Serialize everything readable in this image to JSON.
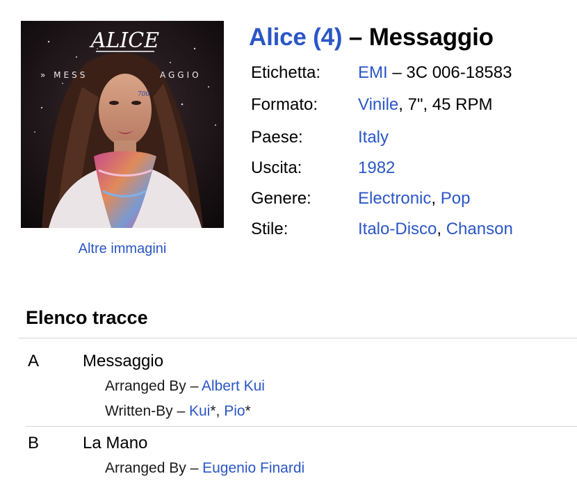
{
  "cover": {
    "logo_text": "ALICE",
    "sleeve_left": "» MESS",
    "sleeve_right": "AGGIO",
    "sticker": "700",
    "more_images_link": "Altre immagini"
  },
  "header": {
    "artist": "Alice (4)",
    "separator": " – ",
    "title": "Messaggio"
  },
  "profile": {
    "label_row": {
      "label": "Etichetta:",
      "label_link": "EMI",
      "catalog": " – 3C 006-18583"
    },
    "format_row": {
      "label": "Formato:",
      "format_link": "Vinile",
      "format_rest": ", 7\", 45 RPM"
    },
    "country_row": {
      "label": "Paese:",
      "value": "Italy"
    },
    "released_row": {
      "label": "Uscita:",
      "value": "1982"
    },
    "genre_row": {
      "label": "Genere:",
      "genre_1": "Electronic",
      "sep": ", ",
      "genre_2": "Pop"
    },
    "style_row": {
      "label": "Stile:",
      "style_1": "Italo-Disco",
      "sep": ", ",
      "style_2": "Chanson"
    }
  },
  "tracklist": {
    "heading": "Elenco tracce",
    "tracks": [
      {
        "position": "A",
        "title": "Messaggio",
        "credit_1": {
          "role": "Arranged By – ",
          "name": "Albert Kui"
        },
        "credit_2": {
          "role": "Written-By – ",
          "name_1": "Kui",
          "suffix_1": "*, ",
          "name_2": "Pio",
          "suffix_2": "*"
        }
      },
      {
        "position": "B",
        "title": "La Mano",
        "credit_1": {
          "role": "Arranged By – ",
          "name": "Eugenio Finardi"
        }
      }
    ]
  },
  "colors": {
    "link": "#2a56c6",
    "divider": "#d4d4d4"
  }
}
